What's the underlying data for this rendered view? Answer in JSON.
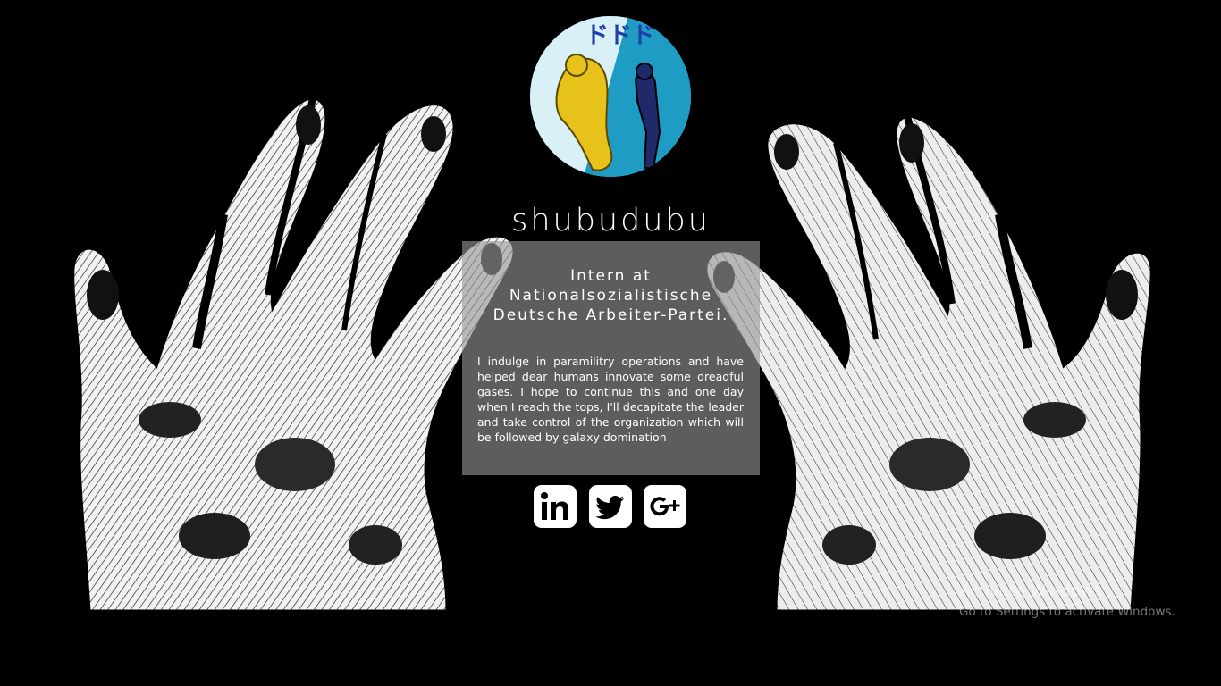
{
  "profile": {
    "name": "shubudubu",
    "role_lines": [
      "Intern at",
      "Nationalsozialistische",
      "Deutsche Arbeiter-Partei."
    ],
    "bio": "I indulge in paramilitry operations and have helped dear humans innovate some dreadful gases. I hope to continue this and one day when I reach the tops, I'll decapitate the leader and take control of the organization which will be followed by galaxy domination"
  },
  "avatar": {
    "icon": "manga-panel-avatar",
    "text": "ドドド"
  },
  "socials": [
    {
      "icon": "linkedin-icon",
      "label": "LinkedIn"
    },
    {
      "icon": "twitter-icon",
      "label": "Twitter"
    },
    {
      "icon": "google-plus-icon",
      "label": "Google+"
    }
  ],
  "watermark": {
    "title": "Activate Windows",
    "subtitle": "Go to Settings to activate Windows."
  },
  "colors": {
    "background": "#000000",
    "panel": "#969696",
    "text": "#ffffff",
    "avatar_sky": "#2bb3d9",
    "avatar_figure": "#e7c21a"
  }
}
